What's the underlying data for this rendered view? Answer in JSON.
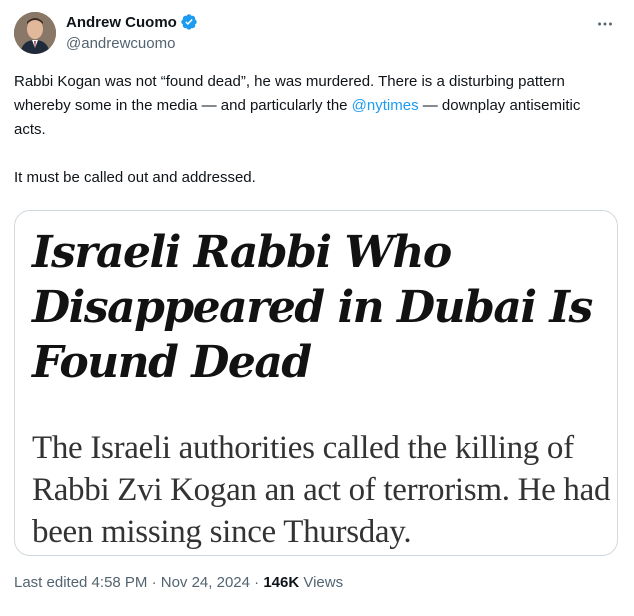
{
  "author": {
    "display_name": "Andrew Cuomo",
    "handle": "@andrewcuomo",
    "verified_badge_color": "#1d9bf0"
  },
  "more_icon": "more-horizontal-icon",
  "tweet": {
    "line_1_before_mention": "Rabbi Kogan was not “found dead”, he was murdered.  There is a disturbing pattern whereby some in the media — and particularly the ",
    "mention": "@nytimes",
    "line_1_after_mention": " — downplay antisemitic acts.",
    "line_2": "It must be called out and addressed."
  },
  "card": {
    "headline": "Israeli Rabbi Who Disappeared in Dubai Is Found Dead",
    "summary": "The Israeli authorities called the killing of Rabbi Zvi Kogan an act of terrorism. He had been missing since Thursday."
  },
  "meta": {
    "edited": "Last edited 4:58 PM · Nov 24, 2024 · ",
    "views_count": "146K",
    "views_label": " Views"
  }
}
